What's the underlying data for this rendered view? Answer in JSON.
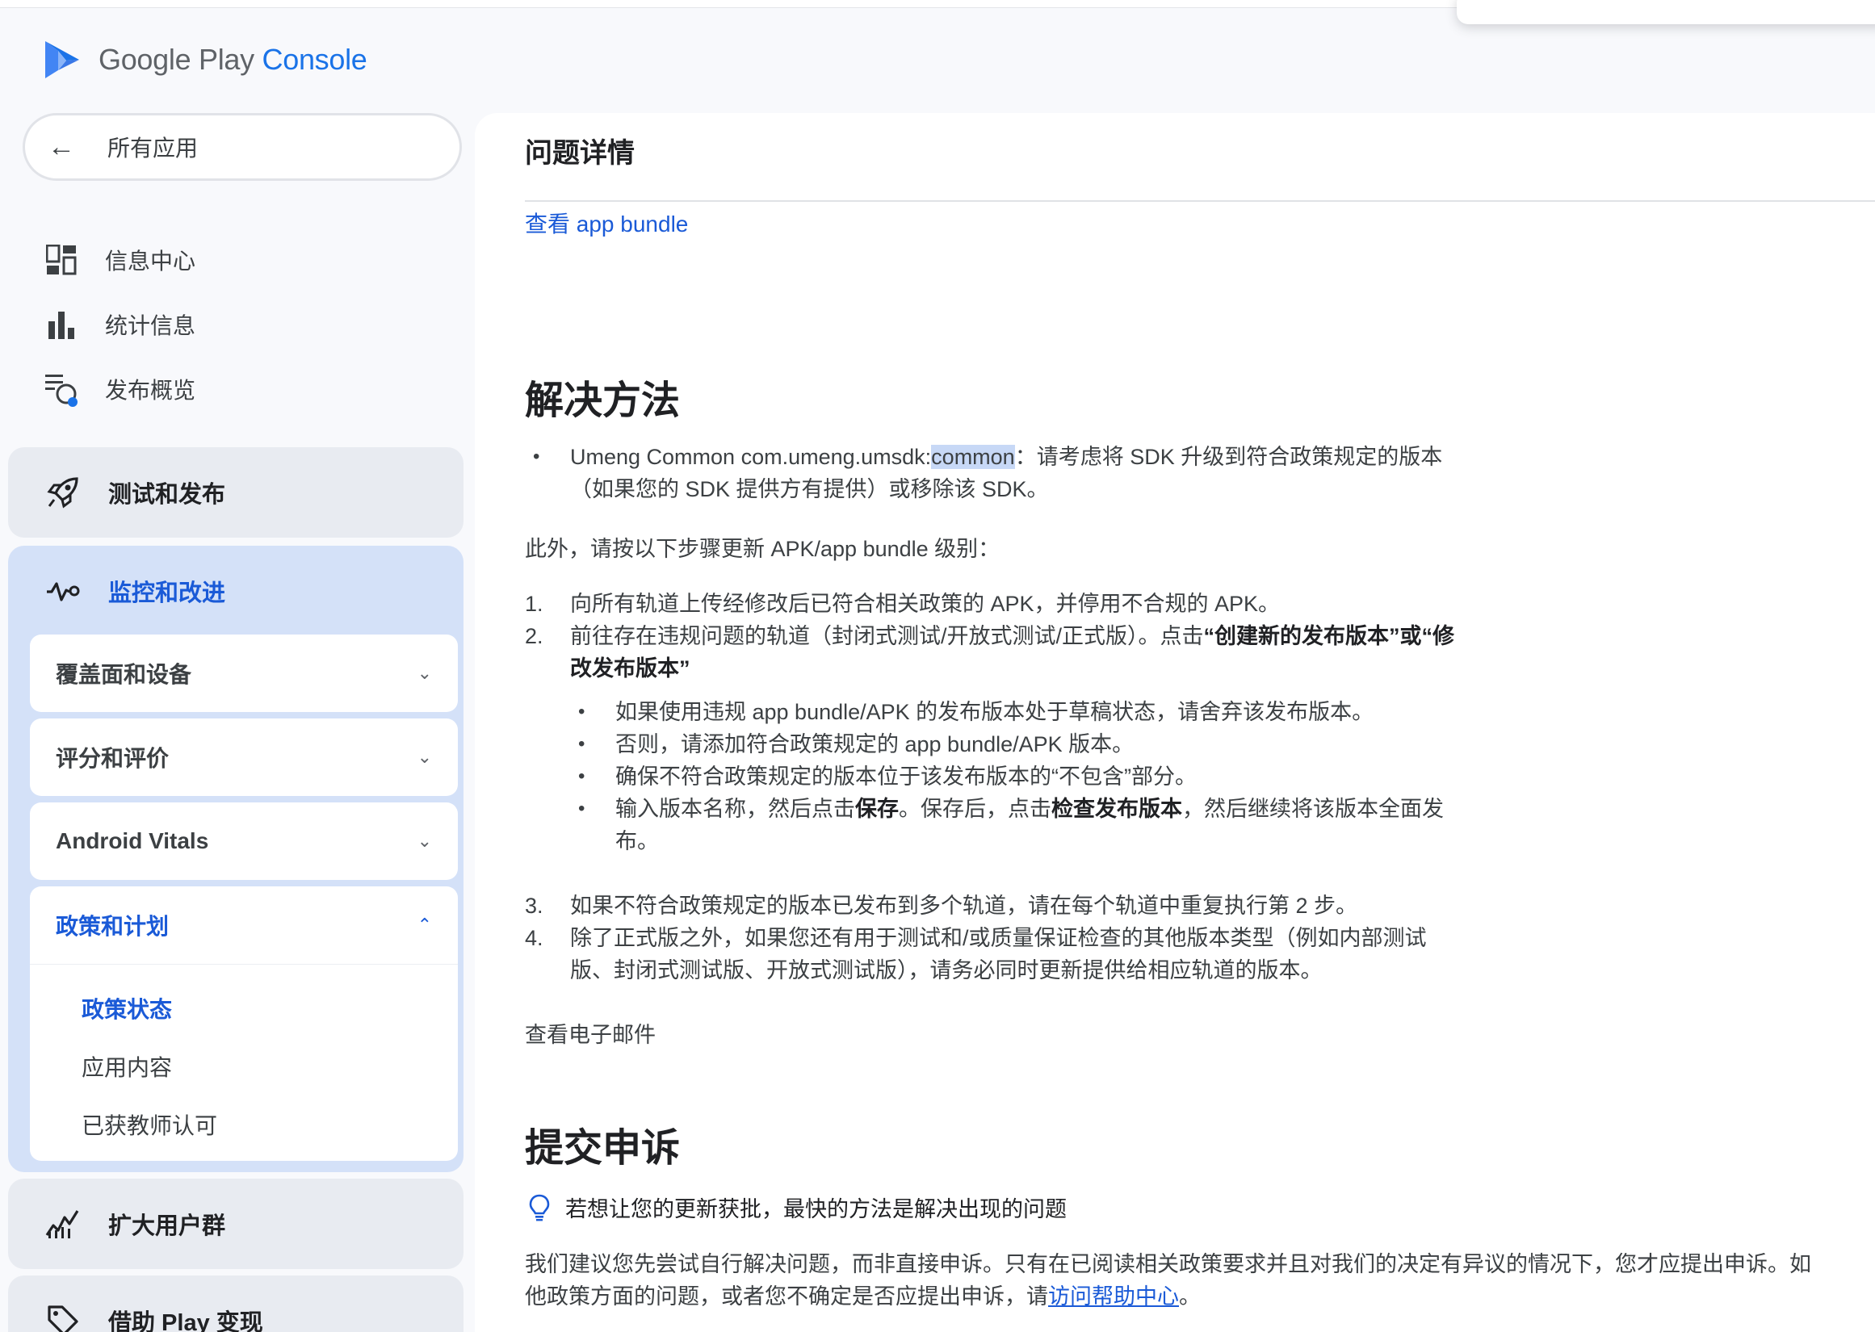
{
  "colors": {
    "accent": "#1a5ad7",
    "active_group_bg": "#d4e1f8",
    "group_bg": "#e8ebf1"
  },
  "logo": {
    "google_play": "Google Play",
    "console": "Console",
    "icon": "play-console-logo-icon"
  },
  "sidebar": {
    "all_apps": "所有应用",
    "items": [
      {
        "label": "信息中心",
        "icon": "dashboard-icon"
      },
      {
        "label": "统计信息",
        "icon": "bar-chart-icon"
      },
      {
        "label": "发布概览",
        "icon": "publishing-overview-icon"
      }
    ],
    "groups": {
      "test_release": {
        "label": "测试和发布",
        "icon": "rocket-icon"
      },
      "monitor": {
        "label": "监控和改进",
        "icon": "monitor-icon",
        "sections": [
          {
            "label": "覆盖面和设备"
          },
          {
            "label": "评分和评价"
          },
          {
            "label": "Android Vitals"
          },
          {
            "label": "政策和计划",
            "children": [
              "政策状态",
              "应用内容",
              "已获教师认可"
            ]
          }
        ]
      },
      "grow": {
        "label": "扩大用户群",
        "icon": "growth-icon"
      },
      "monetize": {
        "label": "借助 Play 变现",
        "icon": "tag-icon"
      }
    }
  },
  "main": {
    "title": "问题详情",
    "view_bundle": "查看 app bundle",
    "solution": {
      "heading": "解决方法",
      "bullet_prefix": "Umeng Common com.umeng.umsdk:",
      "bullet_highlight": "common",
      "bullet_suffix": "：请考虑将 SDK 升级到符合政策规定的版本",
      "bullet_line2": "（如果您的 SDK 提供方有提供）或移除该 SDK。",
      "intro": "此外，请按以下步骤更新 APK/app bundle 级别：",
      "step1": "向所有轨道上传经修改后已符合相关政策的 APK，并停用不合规的 APK。",
      "step2_a": "前往存在违规问题的轨道（封闭式测试/开放式测试/正式版）。点击",
      "step2_b": "“创建新的发布版本”或“修",
      "step2_c": "改发布版本”",
      "sub1": "如果使用违规 app bundle/APK 的发布版本处于草稿状态，请舍弃该发布版本。",
      "sub2": "否则，请添加符合政策规定的 app bundle/APK 版本。",
      "sub3": "确保不符合政策规定的版本位于该发布版本的“不包含”部分。",
      "sub4_a": "输入版本名称，然后点击",
      "sub4_b": "保存",
      "sub4_c": "。保存后，点击",
      "sub4_d": "检查发布版本",
      "sub4_e": "，然后继续将该版本全面发",
      "sub4_f": "布。",
      "step3": "如果不符合政策规定的版本已发布到多个轨道，请在每个轨道中重复执行第 2 步。",
      "step4_a": "除了正式版之外，如果您还有用于测试和/或质量保证检查的其他版本类型（例如内部测试",
      "step4_b": "版、封闭式测试版、开放式测试版），请务必同时更新提供给相应轨道的版本。",
      "view_email": "查看电子邮件"
    },
    "appeal": {
      "heading": "提交申诉",
      "tip": "若想让您的更新获批，最快的方法是解决出现的问题",
      "para_line1": "我们建议您先尝试自行解决问题，而非直接申诉。只有在已阅读相关政策要求并且对我们的决定有异议的情况下，您才应提出申诉。如",
      "para_line2_a": "他政策方面的问题，或者您不确定是否应提出申诉，请",
      "para_link": "访问帮助中心",
      "para_line2_b": "。"
    }
  }
}
